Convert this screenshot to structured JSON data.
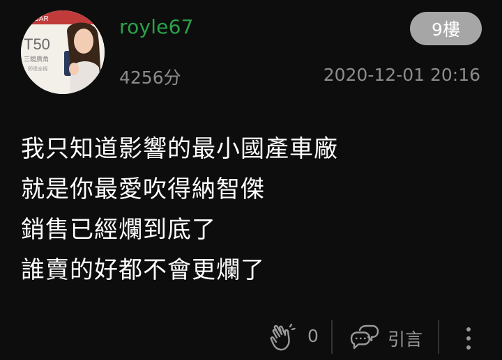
{
  "post": {
    "username": "royle67",
    "score": "4256分",
    "floor": "9樓",
    "timestamp": "2020-12-01 20:16",
    "avatar": {
      "icon": "avatar-image",
      "brand_text": "GAR",
      "model_text": "T50",
      "caption_line1": "三鏡廣角",
      "caption_line2": "即達全視"
    },
    "content_lines": [
      "我只知道影響的最小國產車廠",
      "就是你最愛吹得納智傑",
      "銷售已經爛到底了",
      "誰賣的好都不會更爛了"
    ]
  },
  "actions": {
    "like_icon": "clap-hands-icon",
    "like_count": "0",
    "quote_icon": "quote-bubble-icon",
    "quote_label": "引言",
    "more_icon": "more-vertical-icon"
  },
  "colors": {
    "background": "#0d0d0d",
    "username": "#2aa14a",
    "muted": "#8c8c8c",
    "badge": "#a6a6a6"
  }
}
